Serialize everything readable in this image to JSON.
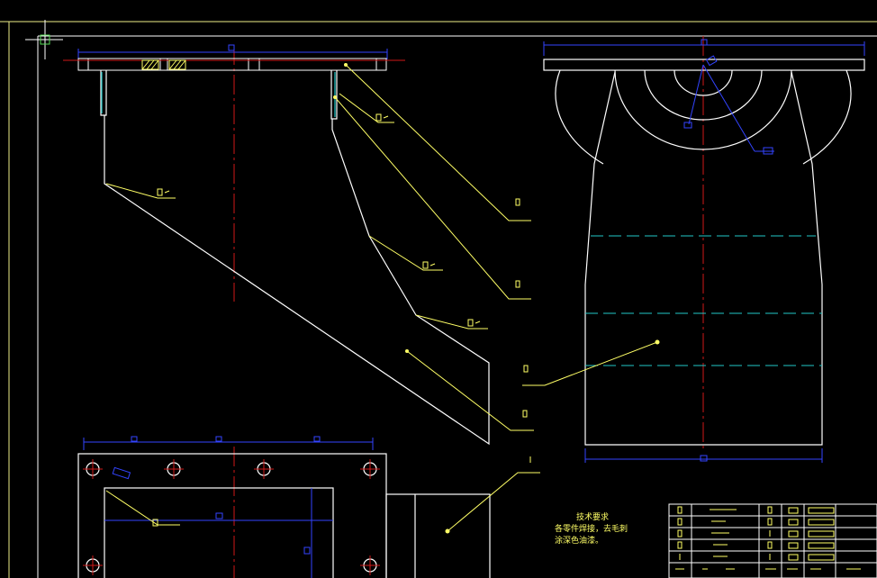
{
  "colors": {
    "background": "#000000",
    "outline": "#ffffff",
    "leader": "#ffff66",
    "dimension": "#3344ff",
    "centerline": "#d01818",
    "hidden": "#22c8c8",
    "frame": "#eeee88",
    "titleblock_text": "#ffff66"
  },
  "technical_requirements": {
    "heading": "技术要求",
    "line1": "各零件焊接，去毛刺",
    "line2": "涂深色油漆。"
  }
}
